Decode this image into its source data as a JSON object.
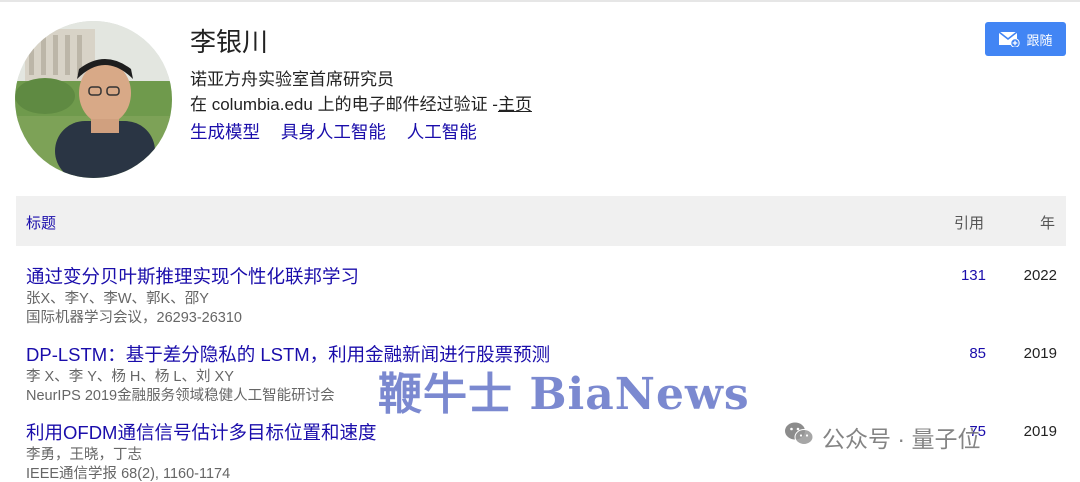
{
  "profile": {
    "name": "李银川",
    "affiliation": "诺亚方舟实验室首席研究员",
    "verified_prefix": "在 columbia.edu 上的电子邮件经过验证 -",
    "homepage_label": "主页",
    "interests": [
      "生成模型",
      "具身人工智能",
      "人工智能"
    ]
  },
  "follow_button": {
    "label": "跟随",
    "icon": "mail-plus-icon",
    "color": "#4285f4"
  },
  "table": {
    "headers": {
      "title": "标题",
      "cited_by": "引用",
      "year": "年"
    },
    "rows": [
      {
        "title": "通过变分贝叶斯推理实现个性化联邦学习",
        "authors": "张X、李Y、李W、郭K、邵Y",
        "venue": "国际机器学习会议，26293-26310",
        "cited_by": "131",
        "year": "2022"
      },
      {
        "title": "DP-LSTM：基于差分隐私的 LSTM，利用金融新闻进行股票预测",
        "authors": "李 X、李 Y、杨 H、杨 L、刘 XY",
        "venue": "NeurIPS 2019金融服务领域稳健人工智能研讨会",
        "cited_by": "85",
        "year": "2019"
      },
      {
        "title": "利用OFDM通信信号估计多目标位置和速度",
        "authors": "李勇，王晓，丁志",
        "venue": "IEEE通信学报 68(2), 1160-1174",
        "cited_by": "75",
        "year": "2019"
      }
    ]
  },
  "watermarks": {
    "bianews": "鞭牛士 BiaNews",
    "qbit": "公众号 · 量子位",
    "qbit_icon": "wechat-icon"
  },
  "colors": {
    "link": "#1a0dab",
    "header_bg": "#f0f0f0",
    "accent": "#4285f4"
  }
}
